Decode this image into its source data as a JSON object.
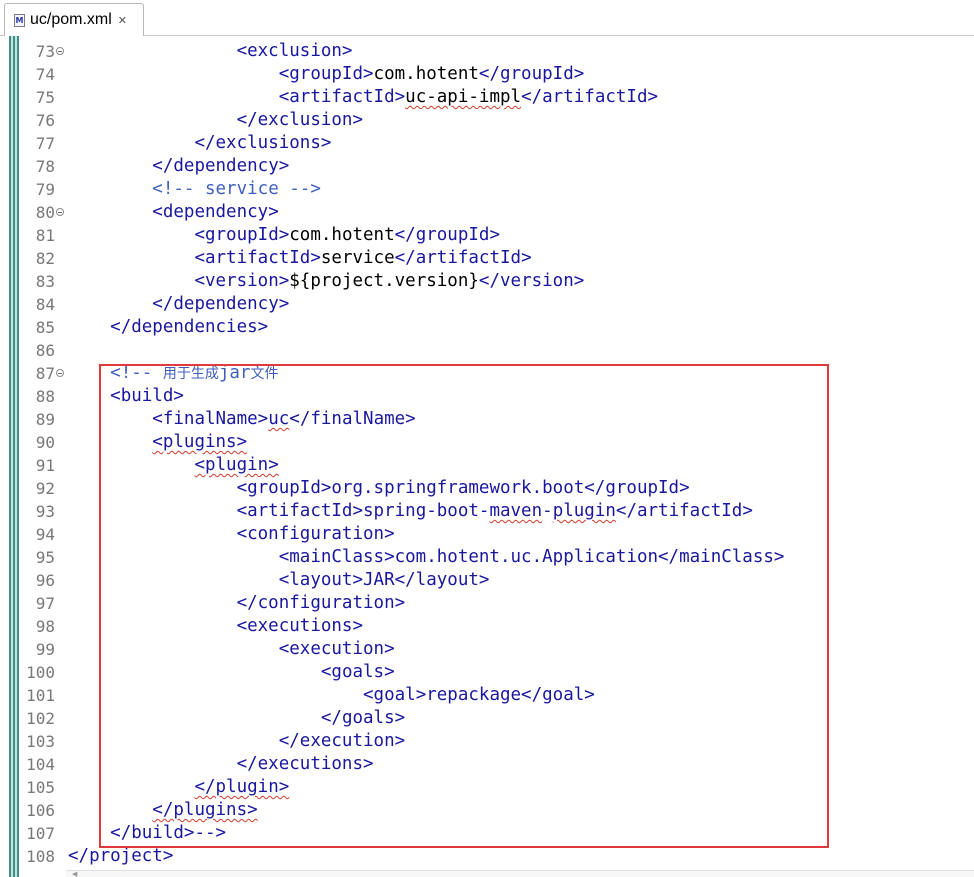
{
  "tab": {
    "title": "uc/pom.xml",
    "close_glyph": "✕",
    "icon_letter": "M"
  },
  "lines": [
    {
      "n": "73",
      "fold": true,
      "indent": 16,
      "tokens": [
        {
          "t": "<exclusion>",
          "c": "tag"
        }
      ]
    },
    {
      "n": "74",
      "fold": false,
      "indent": 20,
      "tokens": [
        {
          "t": "<groupId>",
          "c": "tag"
        },
        {
          "t": "com.hotent"
        },
        {
          "t": "</groupId>",
          "c": "tag"
        }
      ]
    },
    {
      "n": "75",
      "fold": false,
      "indent": 20,
      "tokens": [
        {
          "t": "<artifactId>",
          "c": "tag"
        },
        {
          "t": "uc-api-impl",
          "s": true
        },
        {
          "t": "</artifactId>",
          "c": "tag"
        }
      ]
    },
    {
      "n": "76",
      "fold": false,
      "indent": 16,
      "tokens": [
        {
          "t": "</exclusion>",
          "c": "tag"
        }
      ]
    },
    {
      "n": "77",
      "fold": false,
      "indent": 12,
      "tokens": [
        {
          "t": "</exclusions>",
          "c": "tag"
        }
      ]
    },
    {
      "n": "78",
      "fold": false,
      "indent": 8,
      "tokens": [
        {
          "t": "</dependency>",
          "c": "tag"
        }
      ]
    },
    {
      "n": "79",
      "fold": false,
      "indent": 8,
      "tokens": [
        {
          "t": "<!-- service -->",
          "c": "cmt"
        }
      ]
    },
    {
      "n": "80",
      "fold": true,
      "indent": 8,
      "tokens": [
        {
          "t": "<dependency>",
          "c": "tag"
        }
      ]
    },
    {
      "n": "81",
      "fold": false,
      "indent": 12,
      "tokens": [
        {
          "t": "<groupId>",
          "c": "tag"
        },
        {
          "t": "com.hotent"
        },
        {
          "t": "</groupId>",
          "c": "tag"
        }
      ]
    },
    {
      "n": "82",
      "fold": false,
      "indent": 12,
      "tokens": [
        {
          "t": "<artifactId>",
          "c": "tag"
        },
        {
          "t": "service"
        },
        {
          "t": "</artifactId>",
          "c": "tag"
        }
      ]
    },
    {
      "n": "83",
      "fold": false,
      "indent": 12,
      "tokens": [
        {
          "t": "<version>",
          "c": "tag"
        },
        {
          "t": "${project.version}"
        },
        {
          "t": "</version>",
          "c": "tag"
        }
      ]
    },
    {
      "n": "84",
      "fold": false,
      "indent": 8,
      "tokens": [
        {
          "t": "</dependency>",
          "c": "tag"
        }
      ]
    },
    {
      "n": "85",
      "fold": false,
      "indent": 4,
      "tokens": [
        {
          "t": "</dependencies>",
          "c": "tag"
        }
      ]
    },
    {
      "n": "86",
      "fold": false,
      "indent": 0,
      "tokens": []
    },
    {
      "n": "87",
      "fold": true,
      "indent": 4,
      "tokens": [
        {
          "t": "<!-- ",
          "c": "cmt"
        },
        {
          "t": "用于生成",
          "c": "cmt",
          "cjk": true
        },
        {
          "t": "jar",
          "c": "cmt"
        },
        {
          "t": "文件",
          "c": "cmt",
          "cjk": true
        }
      ]
    },
    {
      "n": "88",
      "fold": false,
      "indent": 4,
      "tokens": [
        {
          "t": "<build>",
          "c": "tag"
        }
      ]
    },
    {
      "n": "89",
      "fold": false,
      "indent": 8,
      "tokens": [
        {
          "t": "<finalName>",
          "c": "tag"
        },
        {
          "t": "uc",
          "c": "tag",
          "s": true
        },
        {
          "t": "</finalName>",
          "c": "tag"
        }
      ]
    },
    {
      "n": "90",
      "fold": false,
      "indent": 8,
      "tokens": [
        {
          "t": "<plugins>",
          "c": "tag",
          "s": true
        }
      ]
    },
    {
      "n": "91",
      "fold": false,
      "indent": 12,
      "tokens": [
        {
          "t": "<plugin>",
          "c": "tag",
          "s": true
        }
      ]
    },
    {
      "n": "92",
      "fold": false,
      "indent": 16,
      "tokens": [
        {
          "t": "<groupId>org.springframework.boot</groupId>",
          "c": "tag"
        }
      ]
    },
    {
      "n": "93",
      "fold": false,
      "indent": 16,
      "tokens": [
        {
          "t": "<artifactId>spring-boot-",
          "c": "tag"
        },
        {
          "t": "maven",
          "c": "tag",
          "s": true
        },
        {
          "t": "-",
          "c": "tag"
        },
        {
          "t": "plugin",
          "c": "tag",
          "s": true
        },
        {
          "t": "</artifactId>",
          "c": "tag"
        }
      ]
    },
    {
      "n": "94",
      "fold": false,
      "indent": 16,
      "tokens": [
        {
          "t": "<configuration>",
          "c": "tag"
        }
      ]
    },
    {
      "n": "95",
      "fold": false,
      "indent": 20,
      "tokens": [
        {
          "t": "<mainClass>com.hotent.uc.Application</mainClass>",
          "c": "tag"
        }
      ]
    },
    {
      "n": "96",
      "fold": false,
      "indent": 20,
      "tokens": [
        {
          "t": "<layout>JAR</layout>",
          "c": "tag"
        }
      ]
    },
    {
      "n": "97",
      "fold": false,
      "indent": 16,
      "tokens": [
        {
          "t": "</configuration>",
          "c": "tag"
        }
      ]
    },
    {
      "n": "98",
      "fold": false,
      "indent": 16,
      "tokens": [
        {
          "t": "<executions>",
          "c": "tag"
        }
      ]
    },
    {
      "n": "99",
      "fold": false,
      "indent": 20,
      "tokens": [
        {
          "t": "<execution>",
          "c": "tag"
        }
      ]
    },
    {
      "n": "100",
      "fold": false,
      "indent": 24,
      "tokens": [
        {
          "t": "<goals>",
          "c": "tag"
        }
      ]
    },
    {
      "n": "101",
      "fold": false,
      "indent": 28,
      "tokens": [
        {
          "t": "<goal>repackage</goal>",
          "c": "tag"
        }
      ]
    },
    {
      "n": "102",
      "fold": false,
      "indent": 24,
      "tokens": [
        {
          "t": "</goals>",
          "c": "tag"
        }
      ]
    },
    {
      "n": "103",
      "fold": false,
      "indent": 20,
      "tokens": [
        {
          "t": "</execution>",
          "c": "tag"
        }
      ]
    },
    {
      "n": "104",
      "fold": false,
      "indent": 16,
      "tokens": [
        {
          "t": "</executions>",
          "c": "tag"
        }
      ]
    },
    {
      "n": "105",
      "fold": false,
      "indent": 12,
      "tokens": [
        {
          "t": "</plugin>",
          "c": "tag",
          "s": true
        }
      ]
    },
    {
      "n": "106",
      "fold": false,
      "indent": 8,
      "tokens": [
        {
          "t": "</plugins>",
          "c": "tag",
          "s": true
        }
      ]
    },
    {
      "n": "107",
      "fold": false,
      "indent": 4,
      "tokens": [
        {
          "t": "</build>-->",
          "c": "tag"
        }
      ]
    },
    {
      "n": "108",
      "fold": false,
      "indent": 0,
      "tokens": [
        {
          "t": "</project>",
          "c": "tag"
        }
      ]
    }
  ],
  "colors": {
    "tag": "#19179e",
    "comment": "#3f5fbf",
    "highlight": "#e03a3e",
    "squiggle": "#d13c2a"
  }
}
